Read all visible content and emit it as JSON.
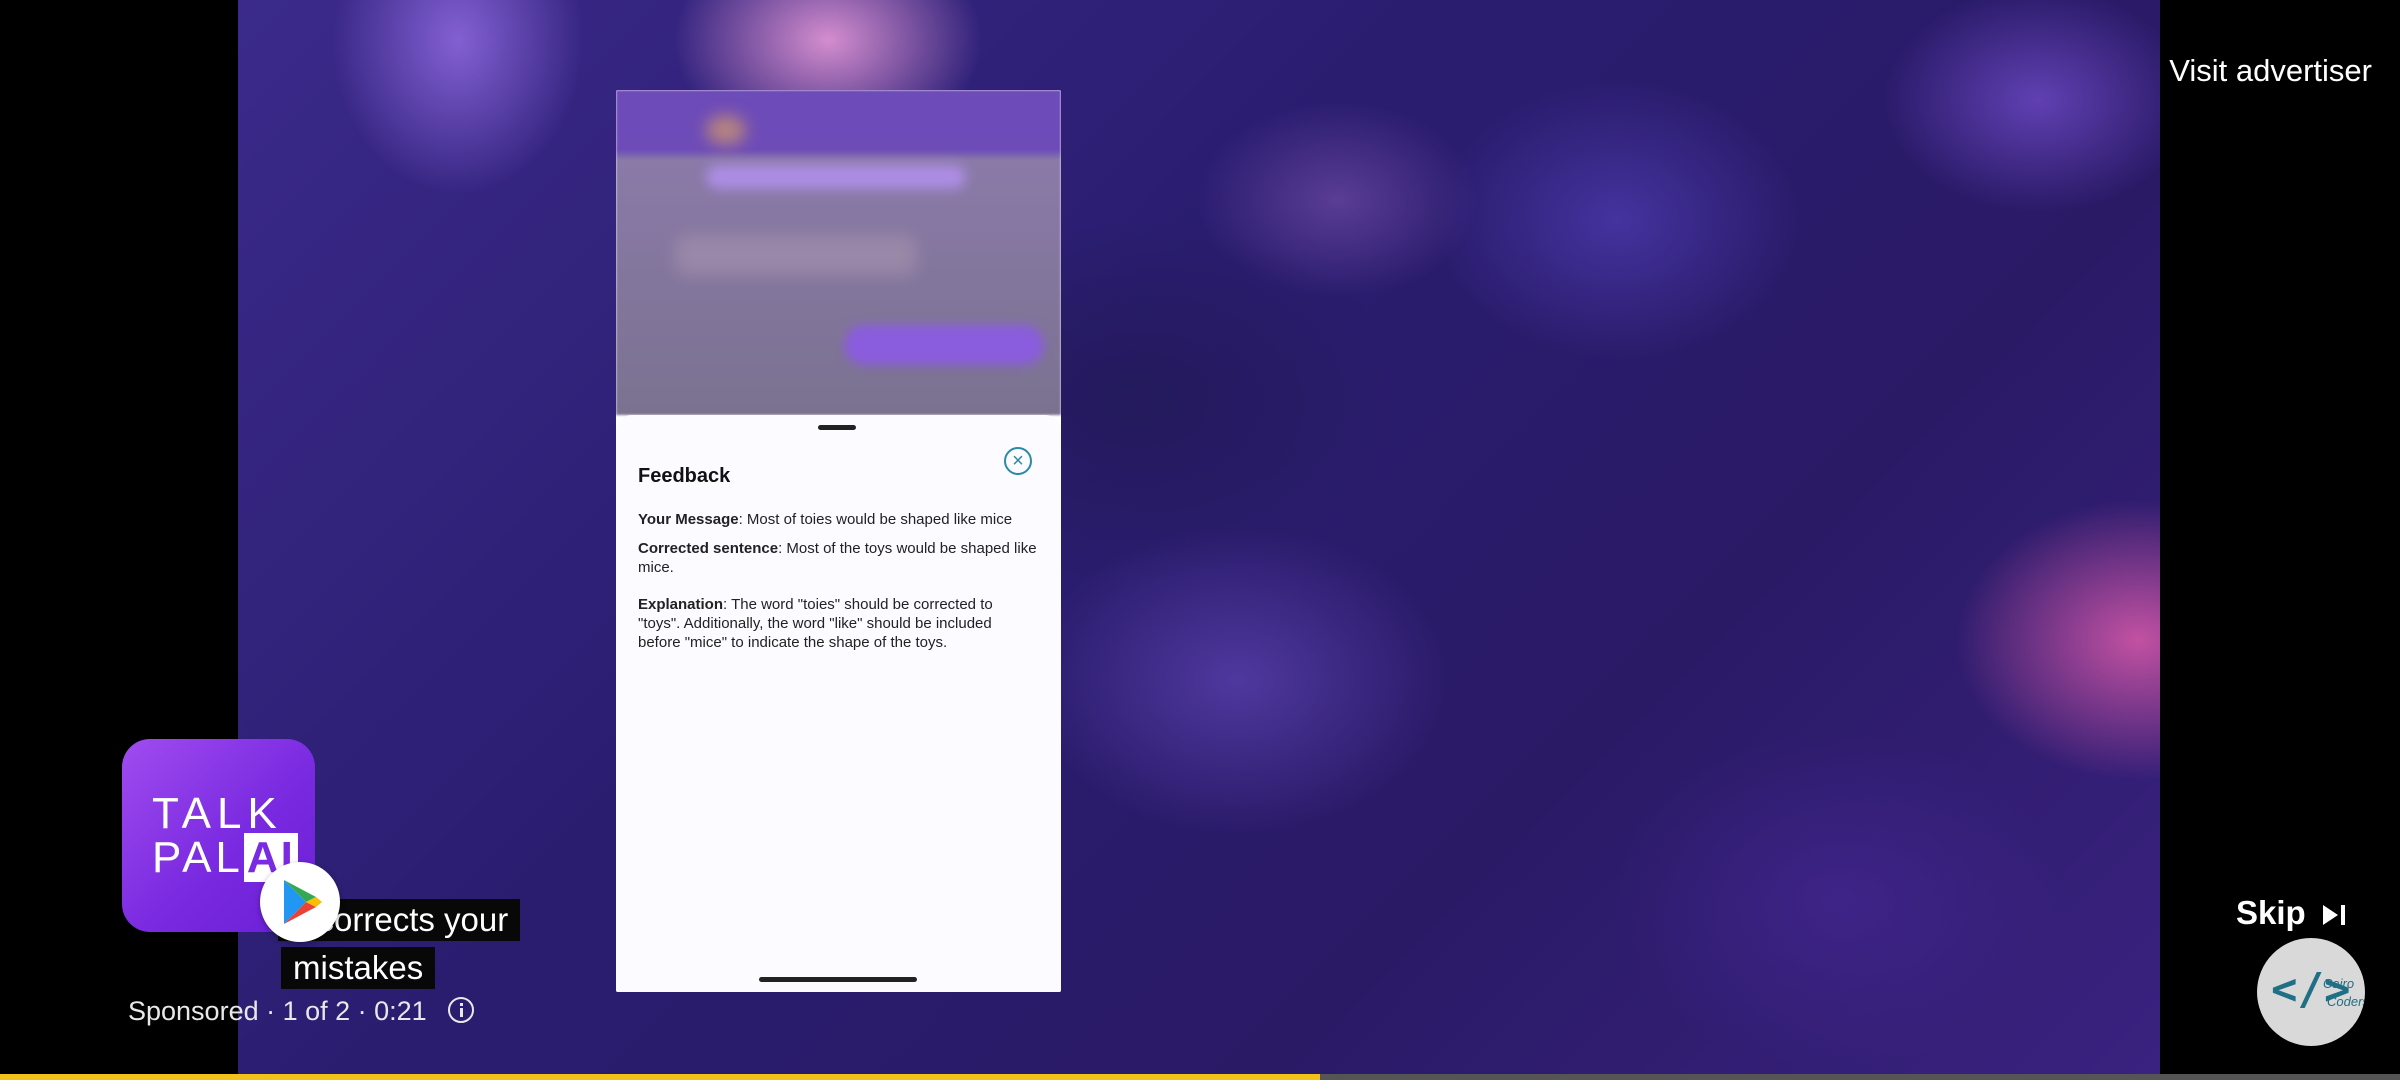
{
  "ad": {
    "visit_advertiser": "Visit advertiser",
    "sponsored_text": "Sponsored · 1 of 2 · 0:21",
    "skip_label": "Skip",
    "progress_fraction": 0.55
  },
  "app_icon": {
    "line1": "TALK",
    "line2": "PAL",
    "badge": "AI"
  },
  "captions": {
    "line1": "d corrects your",
    "line2": "mistakes"
  },
  "feedback_sheet": {
    "title": "Feedback",
    "close_glyph": "×",
    "your_message_label": "Your Message",
    "your_message_text": ": Most of toies would be shaped like mice",
    "corrected_label": "Corrected sentence",
    "corrected_text": ": Most of the toys would be shaped like mice.",
    "explanation_label": "Explanation",
    "explanation_text": ": The word \"toies\" should be corrected to \"toys\". Additionally, the word \"like\" should be included before \"mice\" to indicate the shape of the toys."
  },
  "channel": {
    "code_glyph": "</>",
    "name_line1": "Cairo",
    "name_line2": "Coders"
  },
  "colors": {
    "progress": "#f0c21a",
    "app_icon": "#7a2ae0",
    "close_icon": "#2a8aa8"
  }
}
